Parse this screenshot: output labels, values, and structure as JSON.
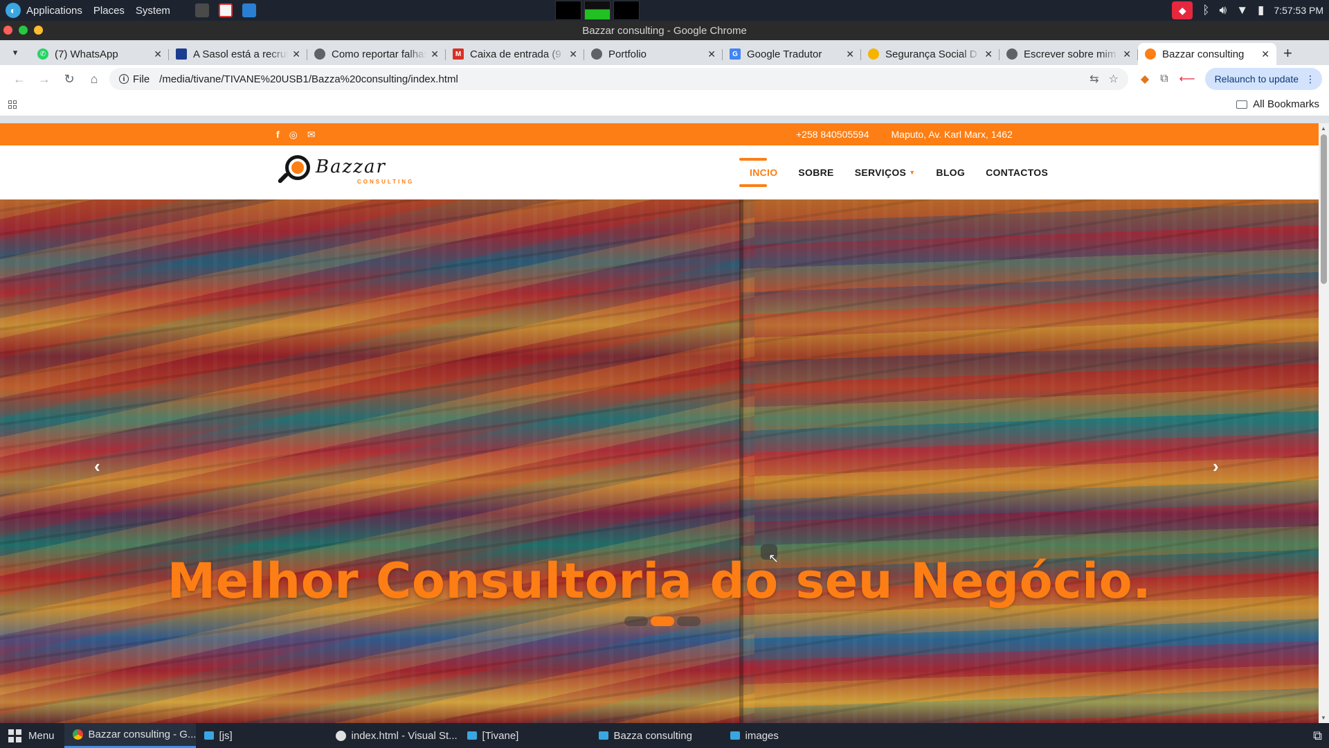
{
  "system_panel": {
    "menus": [
      "Applications",
      "Places",
      "System"
    ],
    "clock": "7:57:53 PM"
  },
  "window": {
    "title": "Bazzar consulting - Google Chrome"
  },
  "tabs": [
    {
      "label": "(7) WhatsApp",
      "favicon_color": "#25d366"
    },
    {
      "label": "A Sasol está a recrutar",
      "favicon_color": "#1a3d8f"
    },
    {
      "label": "Como reportar falhas",
      "favicon_color": "#5f6368"
    },
    {
      "label": "Caixa de entrada (9",
      "favicon_color": "#d93025"
    },
    {
      "label": "Portfolio",
      "favicon_color": "#5f6368"
    },
    {
      "label": "Google Tradutor",
      "favicon_color": "#4285f4"
    },
    {
      "label": "Segurança Social D",
      "favicon_color": "#f4b400"
    },
    {
      "label": "Escrever sobre mim",
      "favicon_color": "#5f6368"
    },
    {
      "label": "Bazzar consulting",
      "favicon_color": "#fd7e14"
    }
  ],
  "toolbar": {
    "chip_label": "File",
    "url": "/media/tivane/TIVANE%20USB1/Bazza%20consulting/index.html",
    "relaunch_label": "Relaunch to update"
  },
  "bookmarks": {
    "all_label": "All Bookmarks"
  },
  "site": {
    "topbar": {
      "phone": "+258 840505594",
      "address": "Maputo, Av. Karl Marx, 1462"
    },
    "logo": {
      "word": "Bazzar",
      "sub": "CONSULTING"
    },
    "nav": [
      {
        "label": "INCIO",
        "active": true
      },
      {
        "label": "SOBRE",
        "active": false
      },
      {
        "label": "SERVIÇOS",
        "active": false,
        "dropdown": true
      },
      {
        "label": "BLOG",
        "active": false
      },
      {
        "label": "CONTACTOS",
        "active": false
      }
    ],
    "hero": {
      "title": "Melhor Consultoria do seu Negócio.",
      "slide_count": 3,
      "active_slide": 2
    },
    "accent_color": "#fd7e14"
  },
  "taskbar": {
    "menu_label": "Menu",
    "items": [
      {
        "label": "Bazzar consulting - G...",
        "active": true
      },
      {
        "label": "[js]",
        "active": false
      },
      {
        "label": "index.html - Visual St...",
        "active": false
      },
      {
        "label": "[Tivane]",
        "active": false
      },
      {
        "label": "Bazza consulting",
        "active": false
      },
      {
        "label": "images",
        "active": false
      }
    ]
  }
}
